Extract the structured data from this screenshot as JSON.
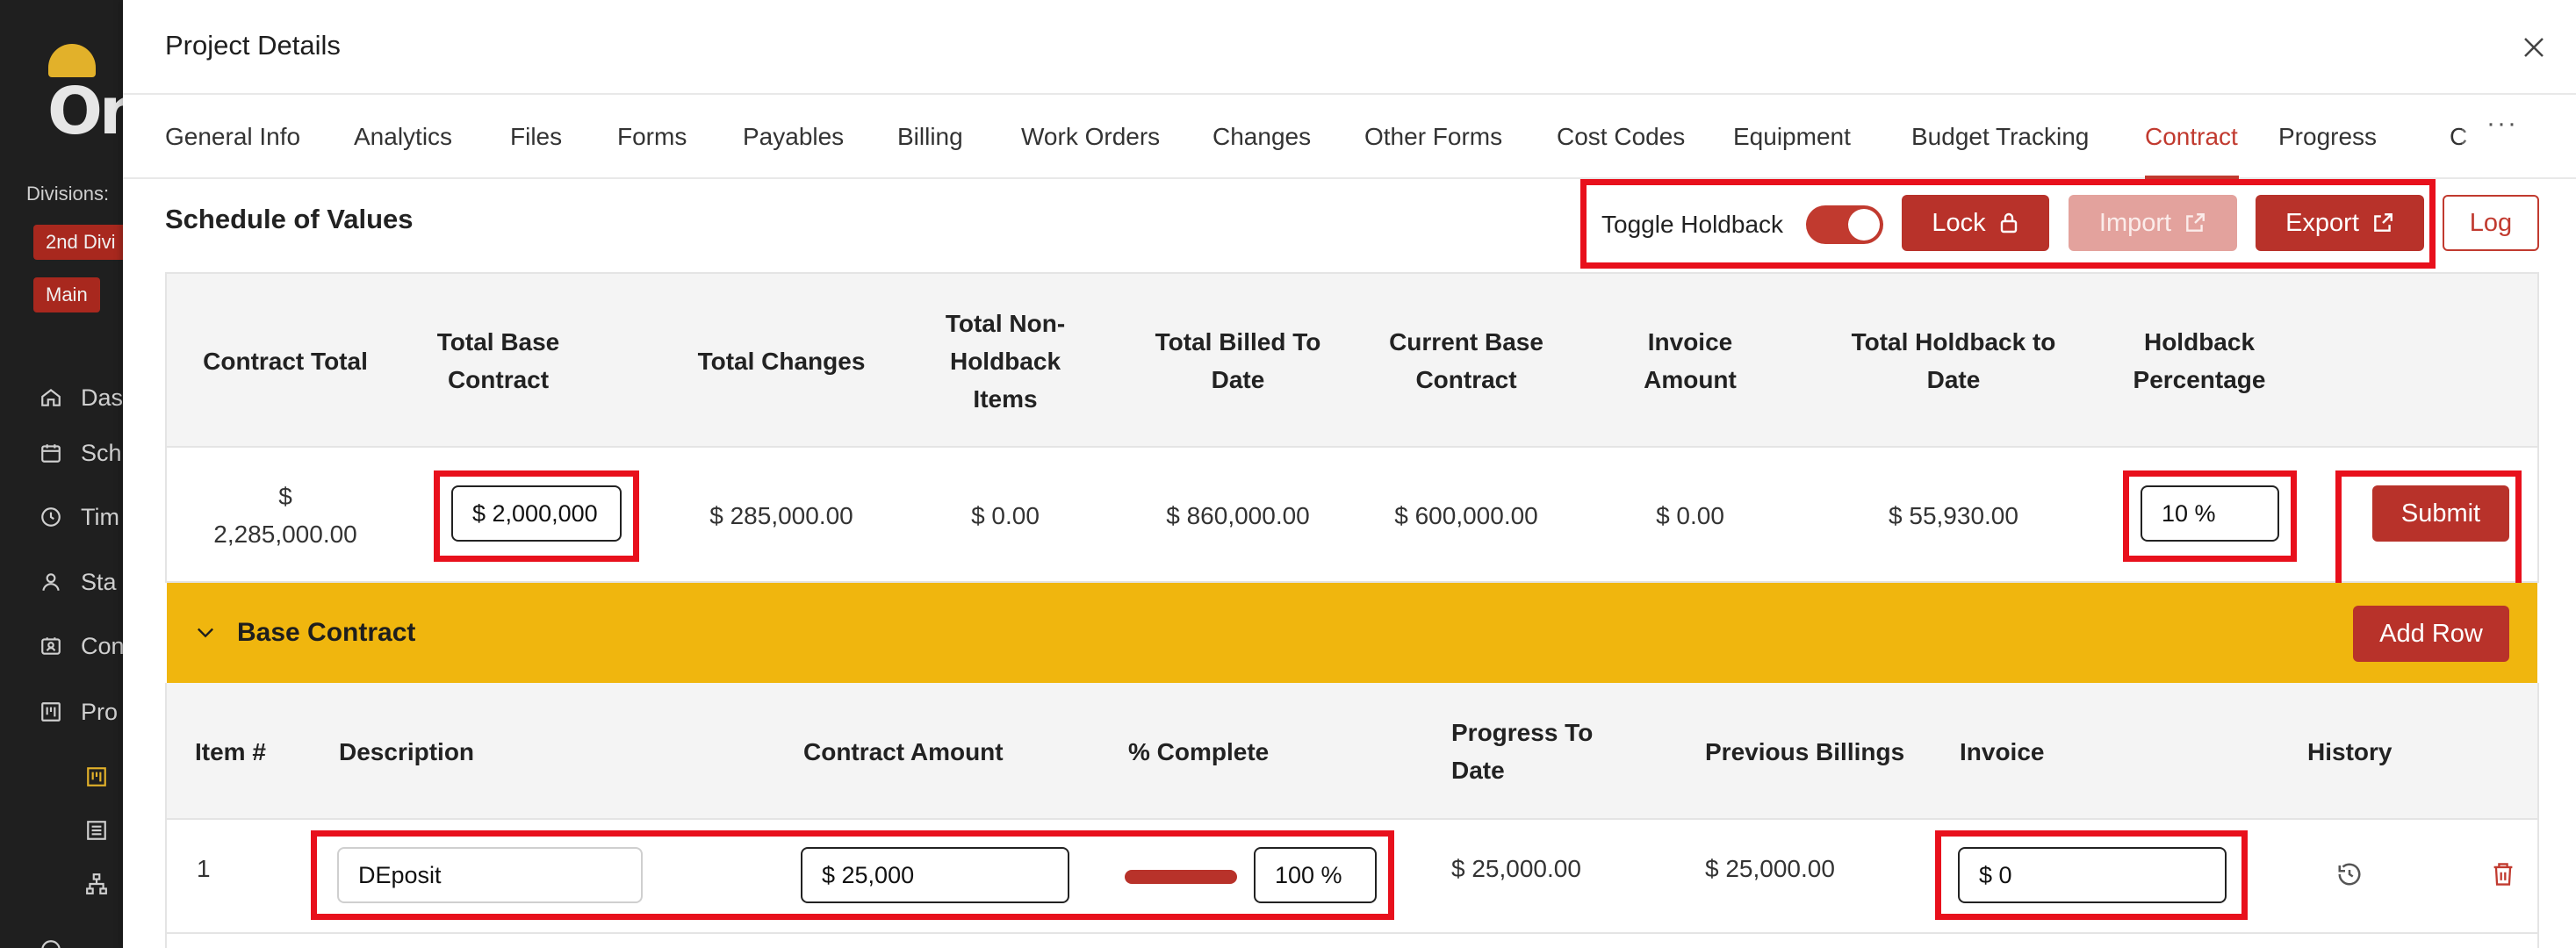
{
  "app_sidebar": {
    "brand_text": "On",
    "divisions_label": "Divisions:",
    "division_chips": [
      "2nd Divi",
      "Main"
    ],
    "nav_items": [
      "Das",
      "Sch",
      "Tim",
      "Sta",
      "Con",
      "Pro"
    ]
  },
  "modal": {
    "title": "Project Details",
    "close_icon": "close-icon"
  },
  "tabs": [
    "General Info",
    "Analytics",
    "Files",
    "Forms",
    "Payables",
    "Billing",
    "Work Orders",
    "Changes",
    "Other Forms",
    "Cost Codes",
    "Equipment",
    "Budget Tracking",
    "Contract",
    "Progress",
    "C"
  ],
  "active_tab": "Contract",
  "tabs_more": "···",
  "schedule": {
    "title": "Schedule of Values",
    "toggle_label": "Toggle Holdback",
    "toggle_on": true,
    "lock_label": "Lock",
    "import_label": "Import",
    "export_label": "Export",
    "log_label": "Log"
  },
  "summary": {
    "headers": [
      "Contract Total",
      "Total Base Contract",
      "Total Changes",
      "Total Non-Holdback Items",
      "Total Billed To Date",
      "Current Base Contract",
      "Invoice Amount",
      "Total Holdback to Date",
      "Holdback Percentage"
    ],
    "values": {
      "contract_total_symbol": "$",
      "contract_total": "2,285,000.00",
      "total_base_contract": "$ 2,000,000",
      "total_changes": "$ 285,000.00",
      "total_non_holdback": "$ 0.00",
      "total_billed": "$ 860,000.00",
      "current_base": "$ 600,000.00",
      "invoice_amount": "$ 0.00",
      "total_holdback": "$ 55,930.00",
      "holdback_percentage": "10 %"
    },
    "submit_label": "Submit"
  },
  "base_contract": {
    "title": "Base Contract",
    "add_row_label": "Add Row"
  },
  "items_table": {
    "headers": [
      "Item #",
      "Description",
      "Contract Amount",
      "% Complete",
      "Progress To Date",
      "Previous Billings",
      "Invoice",
      "History"
    ],
    "rows": [
      {
        "item": "1",
        "description": "DEposit",
        "contract_amount": "$ 25,000",
        "percent_complete": "100 %",
        "percent_value": 100,
        "progress_to_date": "$ 25,000.00",
        "previous_billings": "$ 25,000.00",
        "invoice": "$ 0"
      }
    ]
  },
  "colors": {
    "accent": "#b8322a",
    "band": "#f0b60e",
    "highlight": "#e8101c"
  }
}
